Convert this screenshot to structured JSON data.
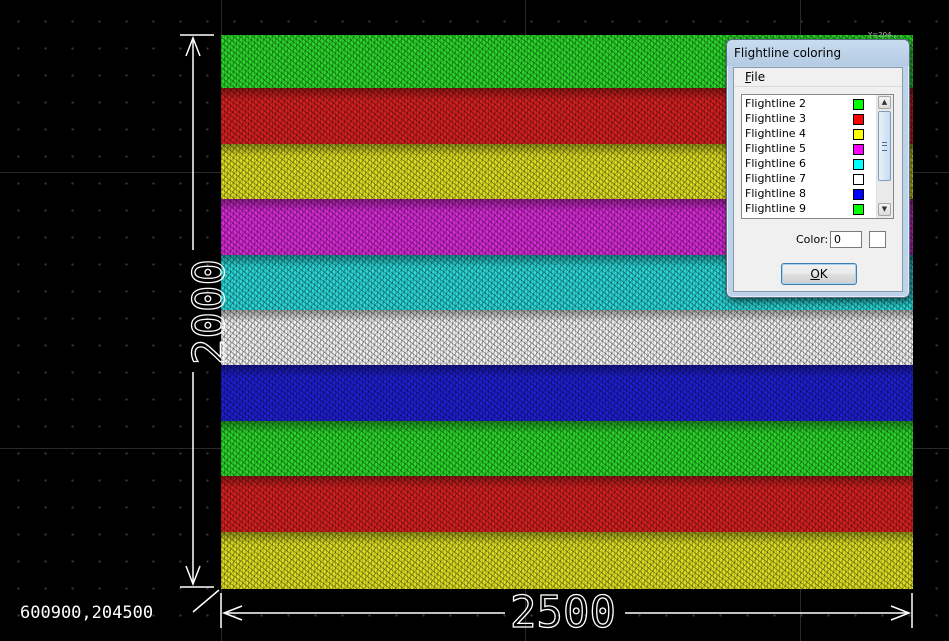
{
  "viewport": {
    "origin_coordinate": "600900,204500",
    "width_dimension": "2500",
    "height_dimension": "2000",
    "corner_tag": "Y=204..."
  },
  "strips": [
    {
      "color": "#2ad52a"
    },
    {
      "color": "#d62020"
    },
    {
      "color": "#dcdc22"
    },
    {
      "color": "#d62ad6"
    },
    {
      "color": "#2ad6d6"
    },
    {
      "color": "#f0f0f0"
    },
    {
      "color": "#1e1ed2"
    },
    {
      "color": "#2ad52a"
    },
    {
      "color": "#d62020"
    },
    {
      "color": "#dcdc22"
    }
  ],
  "dialog": {
    "title": "Flightline coloring",
    "menu": {
      "file_prefix": "",
      "file_underlined": "F",
      "file_rest": "ile"
    },
    "flightlines": [
      {
        "label": "Flightline 2",
        "color": "#00ff00"
      },
      {
        "label": "Flightline 3",
        "color": "#ff0000"
      },
      {
        "label": "Flightline 4",
        "color": "#ffff00"
      },
      {
        "label": "Flightline 5",
        "color": "#ff00ff"
      },
      {
        "label": "Flightline 6",
        "color": "#00ffff"
      },
      {
        "label": "Flightline 7",
        "color": "#ffffff"
      },
      {
        "label": "Flightline 8",
        "color": "#0000ff"
      },
      {
        "label": "Flightline 9",
        "color": "#00ff00"
      }
    ],
    "color_label": "Color:",
    "color_value": "0",
    "ok_underlined": "O",
    "ok_rest": "K"
  }
}
